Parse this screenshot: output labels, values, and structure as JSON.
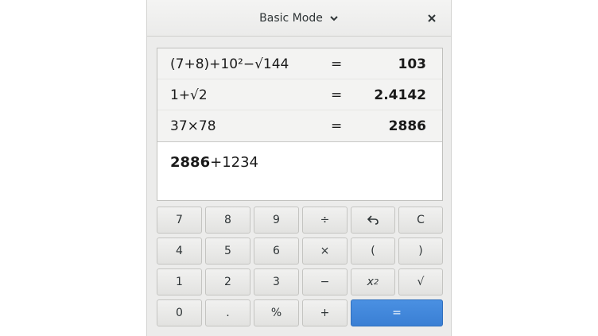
{
  "header": {
    "mode_label": "Basic Mode",
    "mode_icon": "chevron-down-icon",
    "close_icon": "close-icon"
  },
  "history": [
    {
      "expression": "(7+8)+10²−√144",
      "equals": "=",
      "result": "103"
    },
    {
      "expression": "1+√2",
      "equals": "=",
      "result": "2.4142"
    },
    {
      "expression": "37×78",
      "equals": "=",
      "result": "2886"
    }
  ],
  "entry": {
    "bold_part": "2886",
    "rest": "+1234"
  },
  "keys": {
    "k7": "7",
    "k8": "8",
    "k9": "9",
    "divide": "÷",
    "undo_icon": "undo-icon",
    "clear": "C",
    "k4": "4",
    "k5": "5",
    "k6": "6",
    "multiply": "×",
    "lparen": "(",
    "rparen": ")",
    "k1": "1",
    "k2": "2",
    "k3": "3",
    "subtract": "−",
    "square_base": "x",
    "square_exp": "2",
    "sqrt": "√",
    "k0": "0",
    "point": ".",
    "percent": "%",
    "add": "+",
    "equals": "="
  },
  "colors": {
    "accent": "#3a7fd4"
  }
}
